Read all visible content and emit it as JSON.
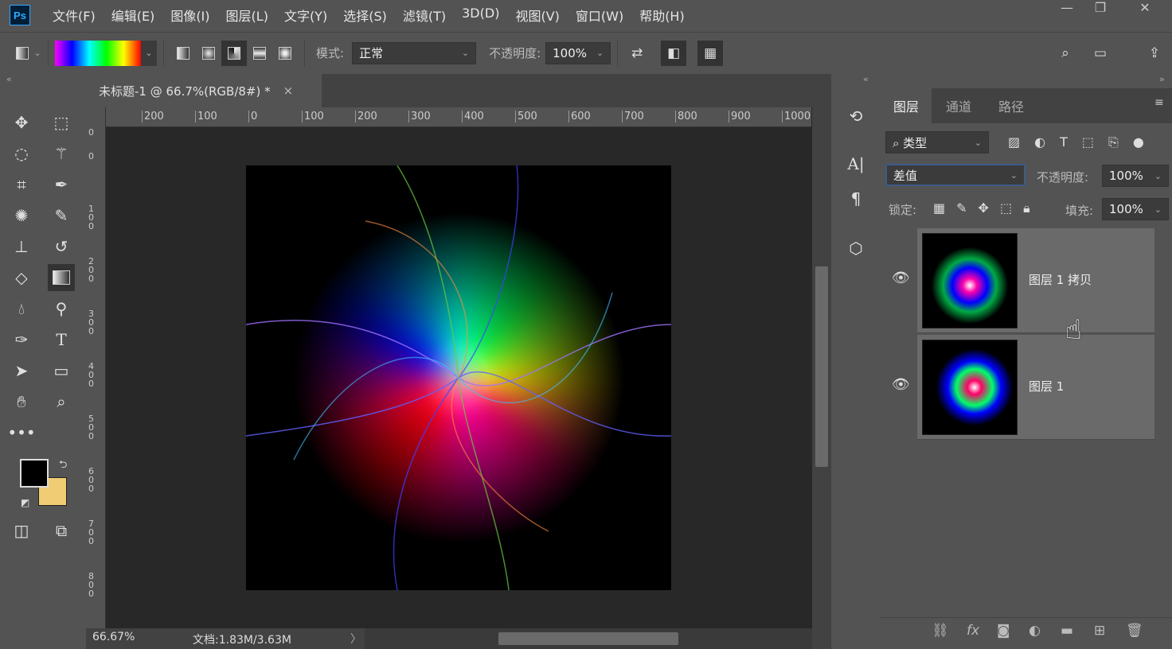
{
  "app": {
    "logo": "Ps",
    "menu": [
      "文件(F)",
      "编辑(E)",
      "图像(I)",
      "图层(L)",
      "文字(Y)",
      "选择(S)",
      "滤镜(T)",
      "3D(D)",
      "视图(V)",
      "窗口(W)",
      "帮助(H)"
    ],
    "window_controls": [
      "minimize",
      "restore",
      "close"
    ]
  },
  "options": {
    "mode_label": "模式:",
    "mode_value": "正常",
    "opacity_label": "不透明度:",
    "opacity_value": "100%",
    "gradient_colors": [
      "#ff00ff",
      "#0000ff",
      "#00ffff",
      "#00ff00",
      "#ffff00",
      "#ff0000"
    ]
  },
  "document": {
    "tab_title": "未标题-1 @ 66.7%(RGB/8#) *",
    "close": "×",
    "ruler_top": [
      "200",
      "100",
      "0",
      "100",
      "200",
      "300",
      "400",
      "500",
      "600",
      "700",
      "800",
      "900",
      "1000"
    ],
    "ruler_left": [
      "0",
      "0",
      "100",
      "200",
      "300",
      "400",
      "500",
      "600",
      "700",
      "800"
    ],
    "zoom": "66.67%",
    "doc_info": "文档:1.83M/3.63M"
  },
  "colors": {
    "foreground": "#000000",
    "background": "#f0cd74",
    "accent": "#31a8ff"
  },
  "layers_panel": {
    "tabs": [
      "图层",
      "通道",
      "路径"
    ],
    "filter": "类型",
    "blend_mode": "差值",
    "opacity_label": "不透明度:",
    "opacity_value": "100%",
    "lock_label": "锁定:",
    "fill_label": "填充:",
    "fill_value": "100%",
    "layers": [
      {
        "name": "图层 1 拷贝",
        "visible": true,
        "selected": true
      },
      {
        "name": "图层 1",
        "visible": true,
        "selected": false
      }
    ]
  }
}
